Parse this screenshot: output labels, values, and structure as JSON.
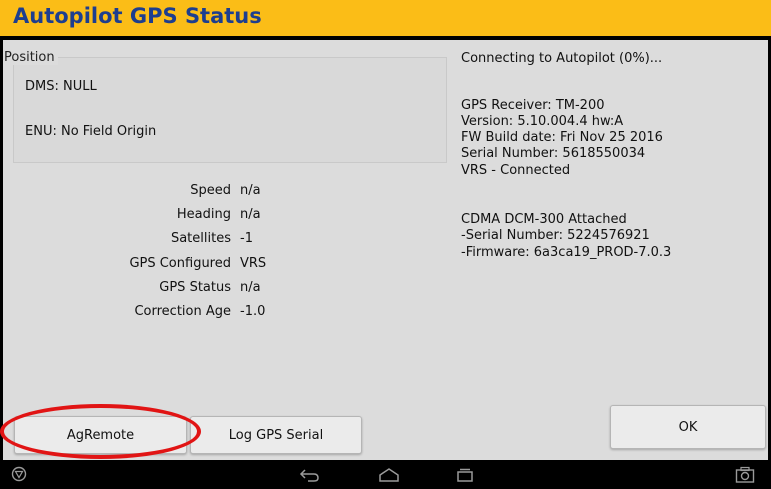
{
  "window": {
    "title": "Autopilot GPS Status"
  },
  "position": {
    "group_label": "Position",
    "dms": "DMS: NULL",
    "enu": "ENU: No Field Origin"
  },
  "stats": [
    {
      "label": "Speed",
      "value": "n/a"
    },
    {
      "label": "Heading",
      "value": "n/a"
    },
    {
      "label": "Satellites",
      "value": "-1"
    },
    {
      "label": "GPS Configured",
      "value": "VRS"
    },
    {
      "label": "GPS Status",
      "value": "n/a"
    },
    {
      "label": "Correction Age",
      "value": "-1.0"
    }
  ],
  "connection": {
    "status": "Connecting to Autopilot (0%)..."
  },
  "receiver": {
    "line1": "GPS Receiver: TM-200",
    "line2": "Version: 5.10.004.4 hw:A",
    "line3": "FW Build date: Fri Nov 25 2016",
    "line4": "Serial Number: 5618550034",
    "line5": "VRS - Connected"
  },
  "modem": {
    "line1": "CDMA DCM-300 Attached",
    "line2": "-Serial Number: 5224576921",
    "line3": "-Firmware: 6a3ca19_PROD-7.0.3"
  },
  "buttons": {
    "agremote": "AgRemote",
    "log_gps_serial": "Log GPS Serial",
    "ok": "OK"
  },
  "colors": {
    "title_bar": "#fbbd17",
    "title_text": "#1d3e8f",
    "panel": "#dcdcdc",
    "annotation": "#e11414"
  },
  "navbar": {
    "icons": [
      "trimble-logo-icon",
      "back-icon",
      "home-icon",
      "recent-apps-icon",
      "screenshot-icon"
    ]
  }
}
